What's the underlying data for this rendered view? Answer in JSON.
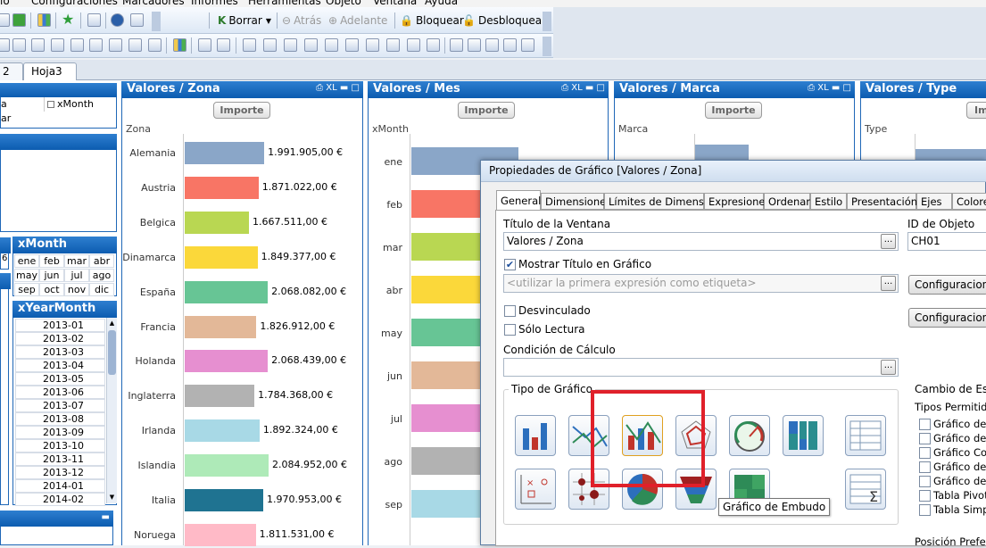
{
  "menu": [
    "lo",
    "Configuraciones",
    "Marcadores",
    "Informes",
    "Herramientas",
    "Objeto",
    "Ventana",
    "Ayuda"
  ],
  "toolbar": {
    "borrar": "Borrar",
    "atras": "Atrás",
    "adelante": "Adelante",
    "bloquear": "Bloquear",
    "desbloquear": "Desbloquear"
  },
  "sheet_tabs": [
    "2",
    "Hoja3"
  ],
  "left_panel": {
    "table_col1": [
      "a",
      "ar"
    ],
    "table_header2": "xMonth",
    "xmonth_title": "xMonth",
    "xmonth_side": "6",
    "months": [
      "ene",
      "feb",
      "mar",
      "abr",
      "may",
      "jun",
      "jul",
      "ago",
      "sep",
      "oct",
      "nov",
      "dic"
    ],
    "xyearmonth_title": "xYearMonth",
    "yearmonths": [
      "2013-01",
      "2013-02",
      "2013-03",
      "2013-04",
      "2013-05",
      "2013-06",
      "2013-07",
      "2013-08",
      "2013-09",
      "2013-10",
      "2013-11",
      "2013-12",
      "2014-01",
      "2014-02"
    ]
  },
  "chart_zona": {
    "title": "Valores / Zona",
    "ctl": "XL",
    "button": "Importe",
    "axis_title": "Zona"
  },
  "chart_data": [
    {
      "type": "bar",
      "title": "Valores / Zona",
      "xlabel": "Zona",
      "ylabel": "Importe",
      "categories": [
        "Alemania",
        "Austria",
        "Belgica",
        "Dinamarca",
        "España",
        "Francia",
        "Holanda",
        "Inglaterra",
        "Irlanda",
        "Islandia",
        "Italia",
        "Noruega"
      ],
      "values": [
        1991905,
        1871022,
        1667511,
        1849377,
        2068082,
        1826912,
        2068439,
        1784368,
        1892324,
        2084952,
        1970953,
        1811531
      ],
      "value_labels": [
        "1.991.905,00 €",
        "1.871.022,00 €",
        "1.667.511,00 €",
        "1.849.377,00 €",
        "2.068.082,00 €",
        "1.826.912,00 €",
        "2.068.439,00 €",
        "1.784.368,00 €",
        "1.892.324,00 €",
        "2.084.952,00 €",
        "1.970.953,00 €",
        "1.811.531,00 €"
      ],
      "colors": [
        "#8aa6c8",
        "#f87565",
        "#b9d752",
        "#fbd83a",
        "#67c595",
        "#e3b898",
        "#e68fd0",
        "#b2b2b2",
        "#a8d9e6",
        "#aeeab8",
        "#1f7391",
        "#ffbac7"
      ]
    },
    {
      "type": "bar",
      "title": "Valores / Mes",
      "xlabel": "xMonth",
      "ylabel": "Importe",
      "categories": [
        "ene",
        "feb",
        "mar",
        "abr",
        "may",
        "jun",
        "jul",
        "ago",
        "sep"
      ],
      "colors": [
        "#8aa6c8",
        "#f87565",
        "#b9d752",
        "#fbd83a",
        "#67c595",
        "#e3b898",
        "#e68fd0",
        "#b2b2b2",
        "#a8d9e6"
      ]
    }
  ],
  "chart_mes": {
    "title": "Valores / Mes",
    "ctl": "XL",
    "button": "Importe",
    "axis_title": "xMonth"
  },
  "chart_marca": {
    "title": "Valores / Marca",
    "ctl": "XL",
    "button": "Importe",
    "axis_title": "Marca"
  },
  "chart_type": {
    "title": "Valores / Type",
    "button": "Im",
    "axis_title": "Type"
  },
  "dialog": {
    "title": "Propiedades de Gráfico [Valores / Zona]",
    "tabs": [
      "General",
      "Dimensiones",
      "Límites de Dimensión",
      "Expresiones",
      "Ordenar",
      "Estilo",
      "Presentación",
      "Ejes",
      "Colores"
    ],
    "window_title_label": "Título de la Ventana",
    "window_title_value": "Valores / Zona",
    "object_id_label": "ID de Objeto",
    "object_id_value": "CH01",
    "show_title_label": "Mostrar Título en Gráfico",
    "title_placeholder": "<utilizar la primera expresión como etiqueta>",
    "config_button": "Configuraciones",
    "config_button2": "Configuraciones d",
    "unlinked_label": "Desvinculado",
    "readonly_label": "Sólo Lectura",
    "calc_condition_label": "Condición de Cálculo",
    "chart_type_label": "Tipo de Gráfico",
    "tooltip": "Gráfico de Embudo",
    "style_change_label": "Cambio de Estilo",
    "allowed_types_label": "Tipos Permitidos",
    "allowed_types": [
      "Gráfico de Ba",
      "Gráfico de lín",
      "Gráfico Comb",
      "Gráfico de D",
      "Gráfico de Ta",
      "Tabla Pivota",
      "Tabla Simple"
    ],
    "preferred_position_label": "Posición Preferida"
  },
  "colors": {
    "header_blue": "#1565c0",
    "highlight_red": "#e0202a"
  }
}
